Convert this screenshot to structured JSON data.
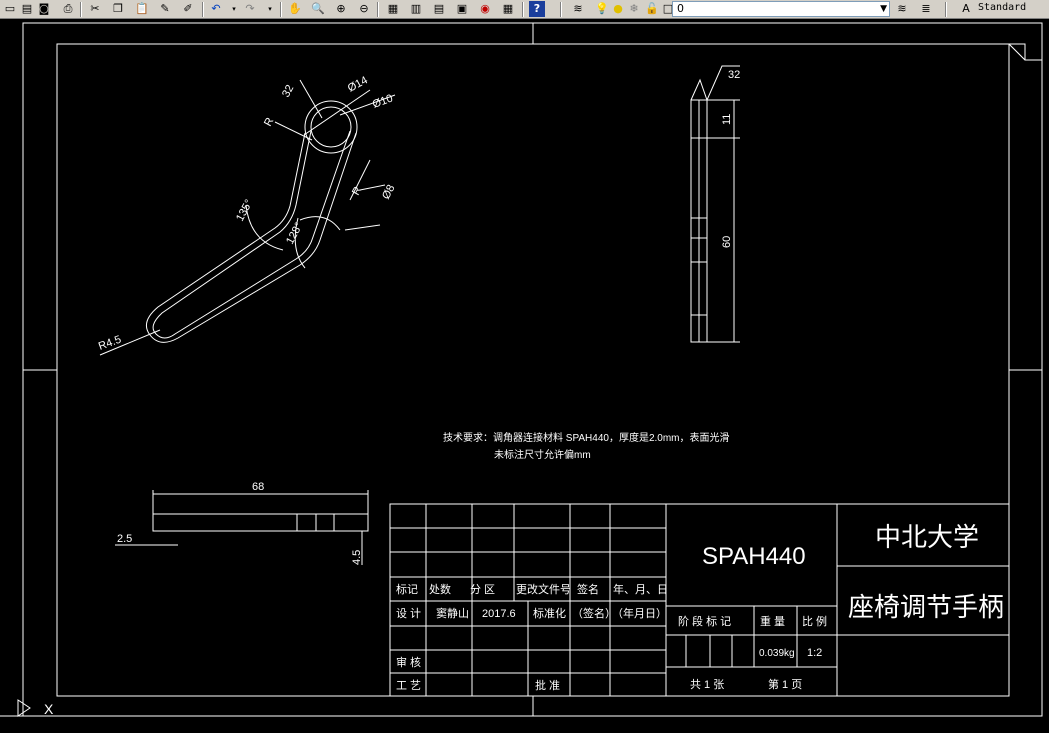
{
  "toolbar": {
    "icons": [
      "new-icon",
      "open-icon",
      "save-icon",
      "print-icon",
      "preview-icon",
      "publish-icon",
      "cut-icon",
      "copy-icon",
      "paste-icon",
      "match-properties-icon",
      "block-editor-icon",
      "undo-icon",
      "redo-icon",
      "pan-icon",
      "zoom-realtime-icon",
      "zoom-window-icon",
      "zoom-previous-icon",
      "properties-icon",
      "design-center-icon",
      "tool-palettes-icon",
      "sheet-set-icon",
      "markup-icon",
      "calculator-icon",
      "help-icon",
      "layer-manager-icon",
      "lightbulb-icon",
      "sun-icon",
      "freeze-icon",
      "lock-icon",
      "color-icon",
      "layer-previous-icon",
      "layer-states-icon",
      "text-style-icon"
    ],
    "layer_value": "0",
    "text_style": "Standard"
  },
  "drawing": {
    "dims_main": {
      "r_small": "R",
      "angle_32": "32",
      "dia14": "Ø14",
      "dia10": "Ø10",
      "angle_135": "135°",
      "angle_128": "128°",
      "r_right": "R",
      "dia8": "Ø8",
      "r45": "R4.5"
    },
    "dims_side": {
      "angle_32": "32",
      "d11": "11",
      "d60": "60"
    },
    "dims_bottom": {
      "d68": "68",
      "d25": "2.5",
      "d45": "4.5"
    },
    "notes": {
      "line1": "技术要求：调角器连接材料 SPAH440，厚度是2.0mm，表面光滑",
      "line2": "未标注尺寸允许偏mm"
    },
    "title_block": {
      "h_mark": "标记",
      "h_count": "处数",
      "h_zone": "分 区",
      "h_docno": "更改文件号",
      "h_sign": "签名",
      "h_date": "年、月、日",
      "design_lbl": "设 计",
      "designer": "窦静山",
      "design_date": "2017.6",
      "std_lbl": "标准化",
      "sign_paren": "（签名）",
      "date_paren": "（年月日）",
      "review_lbl": "审 核",
      "process_lbl": "工 艺",
      "approve_lbl": "批 准",
      "material": "SPAH440",
      "stage_lbl": "阶 段 标 记",
      "weight_lbl": "重 量",
      "scale_lbl": "比 例",
      "weight": "0.039kg",
      "scale": "1:2",
      "sheet_total": "共 1 张",
      "sheet_no": "第 1 页",
      "school": "中北大学",
      "part_name": "座椅调节手柄"
    }
  }
}
